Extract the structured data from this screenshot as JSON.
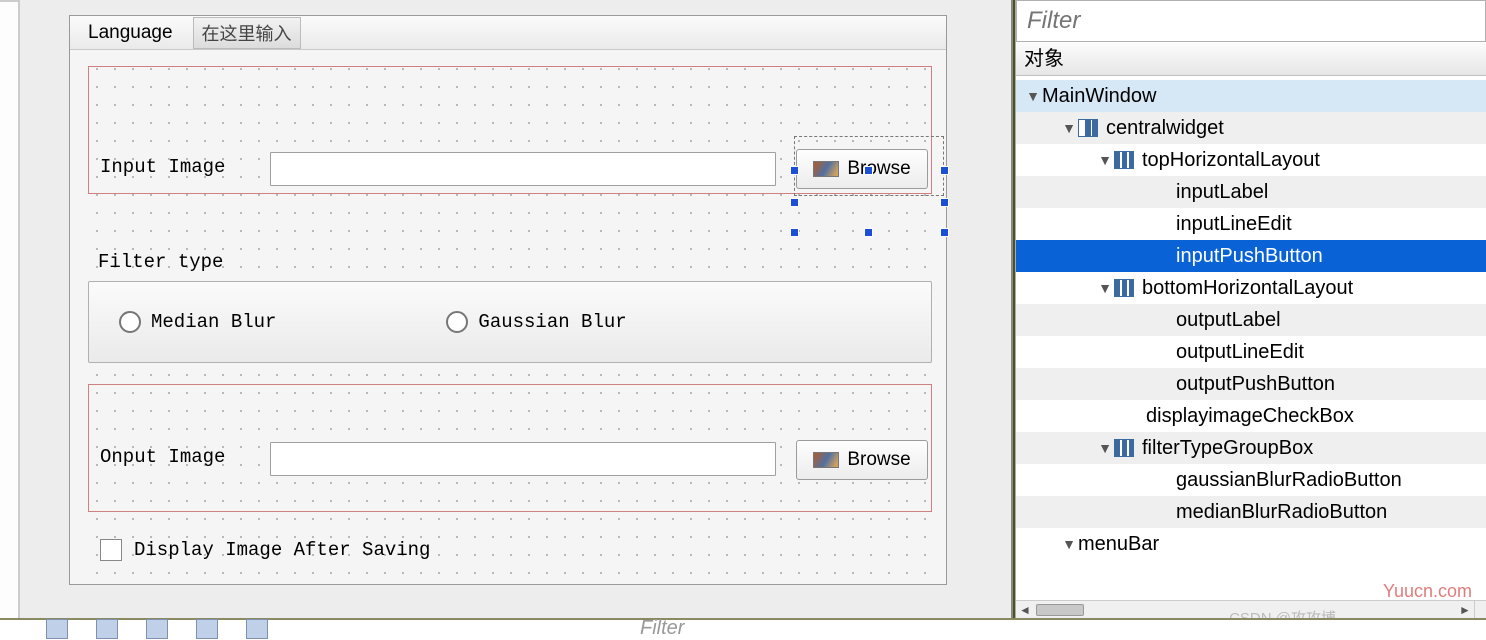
{
  "menu": {
    "language": "Language",
    "type_here": "在这里输入"
  },
  "form": {
    "input_label": "Input Image",
    "output_label": "Onput Image",
    "browse": "Browse",
    "filter_type_label": "Filter type",
    "median_blur": "Median Blur",
    "gaussian_blur": "Gaussian Blur",
    "display_after_save": "Display Image After Saving"
  },
  "inspector": {
    "filter_placeholder": "Filter",
    "column_header": "对象",
    "tree": {
      "root": "MainWindow",
      "centralwidget": "centralwidget",
      "topHorizontalLayout": "topHorizontalLayout",
      "inputLabel": "inputLabel",
      "inputLineEdit": "inputLineEdit",
      "inputPushButton": "inputPushButton",
      "bottomHorizontalLayout": "bottomHorizontalLayout",
      "outputLabel": "outputLabel",
      "outputLineEdit": "outputLineEdit",
      "outputPushButton": "outputPushButton",
      "displayimageCheckBox": "displayimageCheckBox",
      "filterTypeGroupBox": "filterTypeGroupBox",
      "gaussianBlurRadioButton": "gaussianBlurRadioButton",
      "medianBlurRadioButton": "medianBlurRadioButton",
      "menuBar": "menuBar"
    },
    "selected": "inputPushButton"
  },
  "footer": {
    "filter_text": "Filter",
    "watermark": "Yuucn.com",
    "csdn": "CSDN @攻攻博"
  }
}
